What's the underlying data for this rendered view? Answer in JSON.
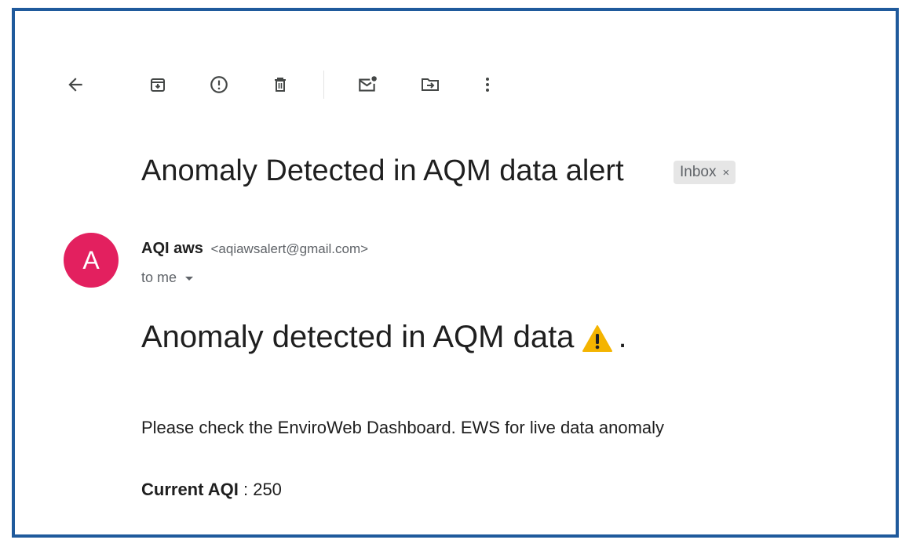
{
  "toolbar": {
    "icons": {
      "back": "arrow-left-icon",
      "archive": "archive-icon",
      "spam": "report-spam-icon",
      "delete": "trash-icon",
      "mark_unread": "mark-unread-icon",
      "move": "move-to-icon",
      "more": "more-vertical-icon"
    }
  },
  "email": {
    "subject": "Anomaly Detected in AQM data alert",
    "label": "Inbox",
    "label_close": "×",
    "sender": {
      "avatar_letter": "A",
      "avatar_color": "#e3205f",
      "name": "AQI aws",
      "email": "<aqiawsalert@gmail.com>"
    },
    "recipient": "to me",
    "body": {
      "headline": "Anomaly detected in AQM data",
      "headline_suffix": ".",
      "warning_icon": "warning-icon",
      "message": "Please check the EnviroWeb Dashboard. EWS for live data anomaly",
      "aqi_label": "Current AQI",
      "aqi_separator": " : ",
      "aqi_value": "250"
    }
  },
  "colors": {
    "frame_border": "#1f5a9c",
    "chip_bg": "#e6e6e6",
    "warning_yellow": "#f4b400"
  }
}
